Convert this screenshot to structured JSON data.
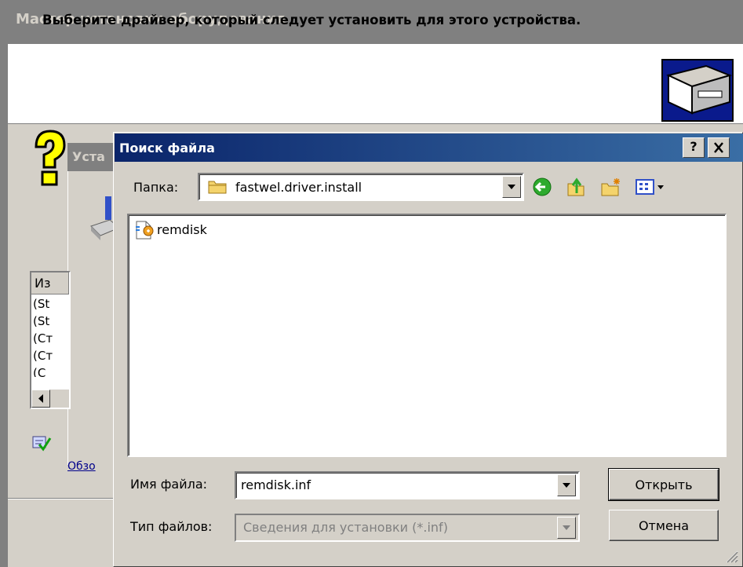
{
  "wizard": {
    "title": "Мастер установки оборудования",
    "header_text": "Выберите драйвер, который следует установить для этого устройства."
  },
  "middle_dialog": {
    "title_fragment": "Уста",
    "list_header": "Из",
    "list_rows": [
      "(St",
      "(St",
      "(Ст",
      "(Ст",
      "(С"
    ],
    "link_fragment": "Обзо"
  },
  "dialog": {
    "title": "Поиск файла",
    "help_label": "?",
    "close_label": "X",
    "folder_label": "Папка:",
    "folder_value": "fastwel.driver.install",
    "files": [
      {
        "name": "remdisk",
        "icon": "setup-info-file-icon"
      }
    ],
    "filename_label": "Имя файла:",
    "filename_value": "remdisk.inf",
    "filetype_label": "Тип файлов:",
    "filetype_value": "Сведения для установки (*.inf)",
    "open_label": "Открыть",
    "cancel_label": "Отмена",
    "toolbar_icons": [
      "back-icon",
      "up-folder-icon",
      "new-folder-icon",
      "view-menu-icon"
    ]
  }
}
